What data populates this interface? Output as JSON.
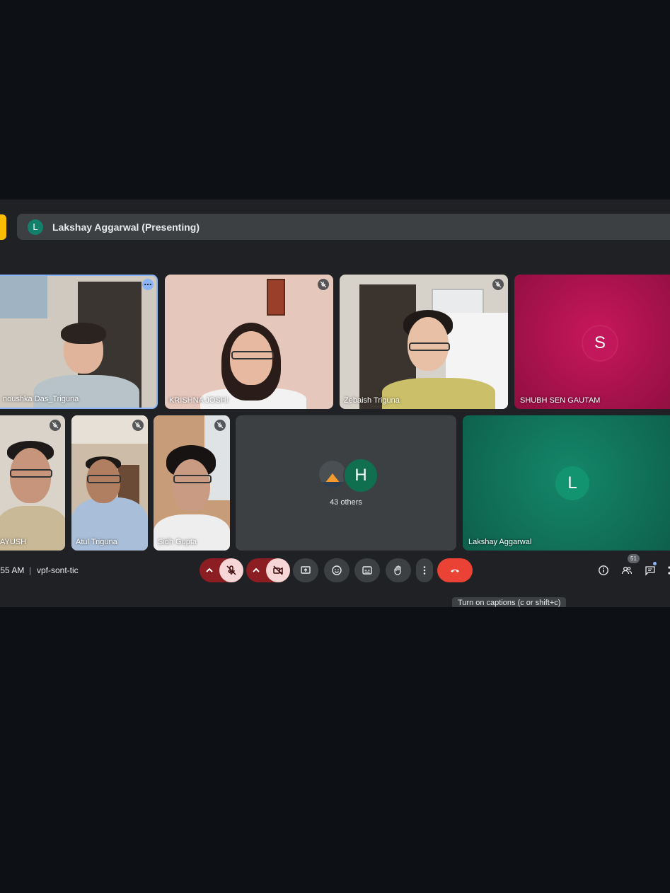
{
  "presenting": {
    "avatar_letter": "L",
    "label": "Lakshay Aggarwal (Presenting)"
  },
  "participants_row1": [
    {
      "name": "noushka Das_Triguna"
    },
    {
      "name": "KRISHNA JOSHI"
    },
    {
      "name": "Zebaish Triguna"
    },
    {
      "name": "SHUBH SEN GAUTAM",
      "avatar_letter": "S"
    }
  ],
  "participants_row2": [
    {
      "name": "AYUSH"
    },
    {
      "name": "Atul Triguna"
    },
    {
      "name": "Sidh Gupta"
    },
    {
      "name": "Lakshay Aggarwal",
      "avatar_letter": "L"
    }
  ],
  "others": {
    "avatar_letter": "H",
    "label": "43 others"
  },
  "meeting": {
    "time": ":55 AM",
    "separator": "|",
    "code": "vpf-sont-tic",
    "participant_count": "51"
  },
  "tooltip": "Turn on captions (c or shift+c)",
  "colors": {
    "present_avatar": "#12806b",
    "shubh_tile": "#b0124e",
    "shubh_avatar": "#c2185b",
    "lakshay_tile": "#127a5e",
    "lakshay_avatar": "#139470",
    "end_call": "#ea4335",
    "muted_control": "#8c1d22"
  }
}
